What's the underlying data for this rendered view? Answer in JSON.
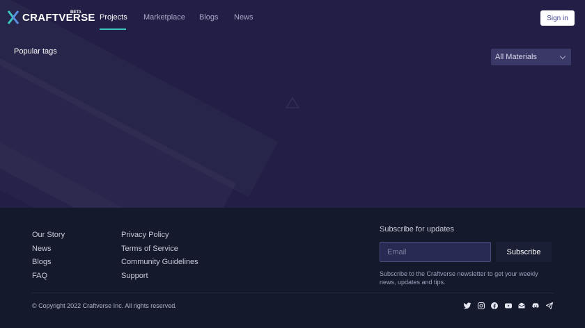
{
  "brand": {
    "name": "CRAFTVERSE",
    "badge": "BETA",
    "accent": "#3cc6c2",
    "hero_bg": "#221e46",
    "footer_bg": "#141a2c"
  },
  "nav": {
    "items": [
      "Projects",
      "Marketplace",
      "Blogs",
      "News"
    ],
    "active": "Projects",
    "signin_label": "Sign in"
  },
  "main": {
    "popular_tags_label": "Popular tags",
    "materials_select": {
      "selected": "All Materials"
    }
  },
  "footer": {
    "col1": [
      "Our Story",
      "News",
      "Blogs",
      "FAQ"
    ],
    "col2": [
      "Privacy Policy",
      "Terms of Service",
      "Community Guidelines",
      "Support"
    ],
    "subscribe": {
      "title": "Subscribe for updates",
      "email_placeholder": "Email",
      "button_label": "Subscribe",
      "description": "Subscribe to the Craftverse newsletter to get your weekly news, updates and tips."
    },
    "copyright": "© Copyright 2022 Craftverse Inc. All rights reserved.",
    "social_icons": [
      "twitter-icon",
      "instagram-icon",
      "facebook-icon",
      "youtube-icon",
      "email-icon",
      "discord-icon",
      "telegram-icon"
    ]
  }
}
